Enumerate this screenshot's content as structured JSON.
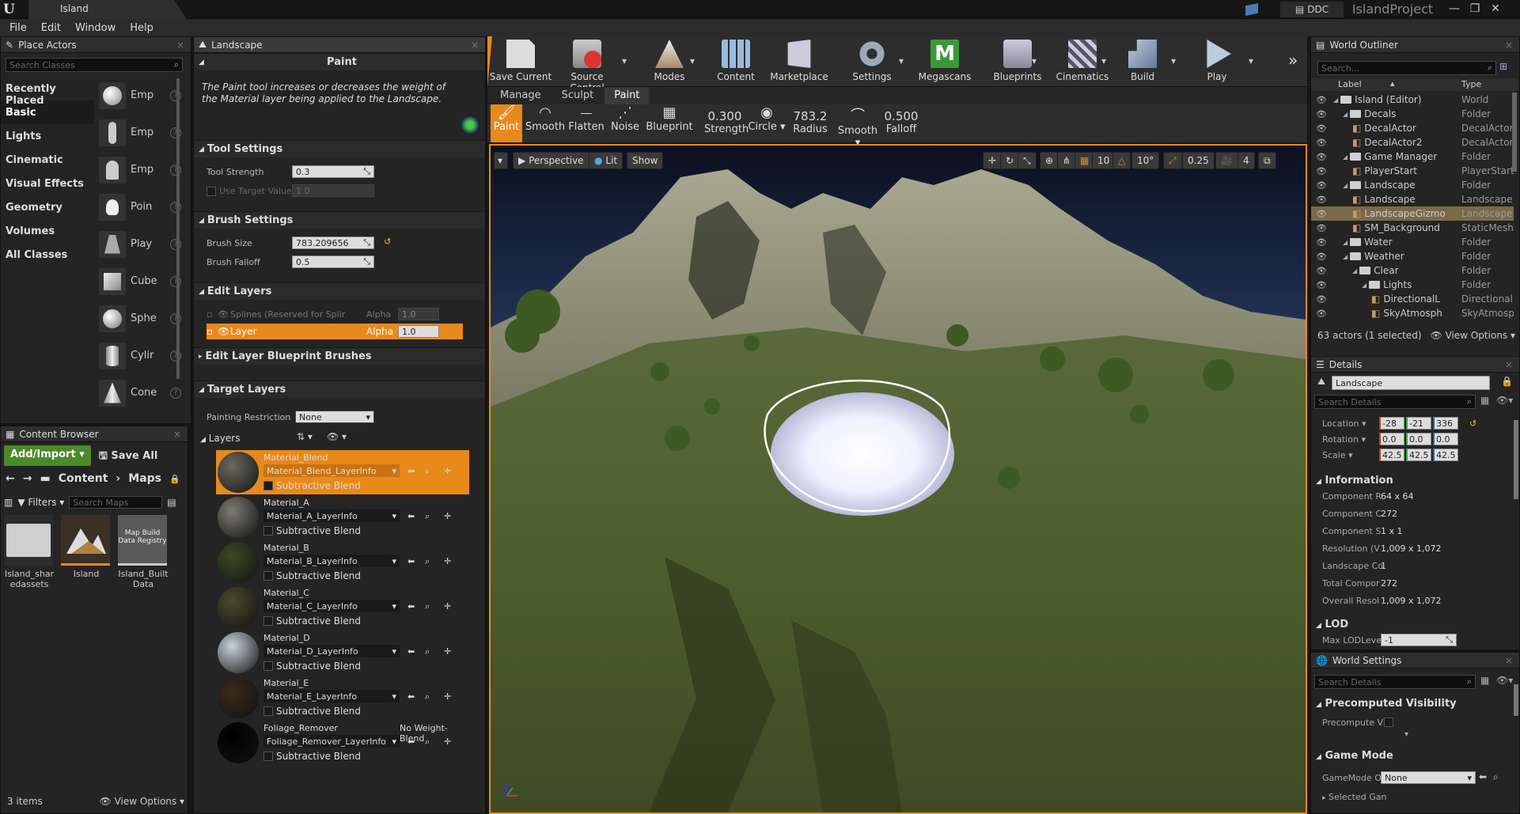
{
  "window": {
    "tab_title": "Island",
    "ddc_label": "DDC",
    "project": "IslandProject"
  },
  "menu": [
    "File",
    "Edit",
    "Window",
    "Help"
  ],
  "place_actors": {
    "title": "Place Actors",
    "search_placeholder": "Search Classes",
    "categories": [
      "Recently Placed",
      "Basic",
      "Lights",
      "Cinematic",
      "Visual Effects",
      "Geometry",
      "Volumes",
      "All Classes"
    ],
    "selected_category": "Basic",
    "items": [
      "Emp",
      "Emp",
      "Emp",
      "Poin",
      "Play",
      "Cube",
      "Sphe",
      "Cylir",
      "Cone"
    ]
  },
  "content_browser": {
    "title": "Content Browser",
    "add_import": "Add/Import",
    "save_all": "Save All",
    "path": [
      "Content",
      "Maps"
    ],
    "filters": "Filters",
    "search_placeholder": "Search Maps",
    "items": [
      {
        "label": "Island_sharedassets",
        "kind": "folder"
      },
      {
        "label": "Island",
        "kind": "map"
      },
      {
        "label": "Island_BuiltData",
        "kind": "registry",
        "thumb_text": "Map Build Data Registry"
      }
    ],
    "status": "3 items",
    "view_options": "View Options"
  },
  "landscape": {
    "title": "Landscape",
    "section": "Paint",
    "description": "The Paint tool increases or decreases the weight of the Material layer being applied to the Landscape.",
    "tool_settings": {
      "header": "Tool Settings",
      "strength_label": "Tool Strength",
      "strength": "0.3",
      "use_target_label": "Use Target Value",
      "target": "1.0"
    },
    "brush_settings": {
      "header": "Brush Settings",
      "size_label": "Brush Size",
      "size": "783.209656",
      "falloff_label": "Brush Falloff",
      "falloff": "0.5"
    },
    "edit_layers": {
      "header": "Edit Layers",
      "rows": [
        {
          "name": "Splines (Reserved for Splir",
          "alpha_label": "Alpha",
          "alpha": "1.0"
        },
        {
          "name": "Layer",
          "alpha_label": "Alpha",
          "alpha": "1.0"
        }
      ]
    },
    "blueprint_brushes": "Edit Layer Blueprint Brushes",
    "target_layers": {
      "header": "Target Layers",
      "restriction_label": "Painting Restriction",
      "restriction": "None",
      "layers_label": "Layers",
      "layers": [
        {
          "name": "Material_Blend",
          "info": "Material_Blend_LayerInfo",
          "sub": "Subtractive Blend",
          "color": "#6b6a5e",
          "extra": ""
        },
        {
          "name": "Material_A",
          "info": "Material_A_LayerInfo",
          "sub": "Subtractive Blend",
          "color": "#7d7b73",
          "extra": ""
        },
        {
          "name": "Material_B",
          "info": "Material_B_LayerInfo",
          "sub": "Subtractive Blend",
          "color": "#3c4a26",
          "extra": ""
        },
        {
          "name": "Material_C",
          "info": "Material_C_LayerInfo",
          "sub": "Subtractive Blend",
          "color": "#4a4a2e",
          "extra": ""
        },
        {
          "name": "Material_D",
          "info": "Material_D_LayerInfo",
          "sub": "Subtractive Blend",
          "color": "#c8d2dc",
          "extra": ""
        },
        {
          "name": "Material_E",
          "info": "Material_E_LayerInfo",
          "sub": "Subtractive Blend",
          "color": "#3a2a1c",
          "extra": ""
        },
        {
          "name": "Foliage_Remover",
          "info": "Foliage_Remover_LayerInfo",
          "sub": "Subtractive Blend",
          "color": "#000000",
          "extra": "No Weight-Blend"
        }
      ]
    }
  },
  "toolbar": {
    "buttons": [
      "Save Current",
      "Source Control",
      "Modes",
      "Content",
      "Marketplace",
      "Settings",
      "Megascans",
      "Blueprints",
      "Cinematics",
      "Build",
      "Play"
    ]
  },
  "mode_tabs": [
    "Manage",
    "Sculpt",
    "Paint"
  ],
  "paint_tools": {
    "tools": [
      "Paint",
      "Smooth",
      "Flatten",
      "Noise",
      "Blueprint"
    ],
    "strength": {
      "value": "0.300",
      "label": "Strength"
    },
    "circle": "Circle",
    "radius": {
      "value": "783.2",
      "label": "Radius"
    },
    "smooth": "Smooth",
    "falloff": {
      "value": "0.500",
      "label": "Falloff"
    }
  },
  "viewport": {
    "perspective": "Perspective",
    "lit": "Lit",
    "show": "Show",
    "grid": "10",
    "angle": "10°",
    "scale": "0.25",
    "speed": "4"
  },
  "outliner": {
    "title": "World Outliner",
    "search_placeholder": "Search...",
    "col_label": "Label",
    "col_type": "Type",
    "rows": [
      {
        "label": "Island (Editor)",
        "type": "World",
        "indent": 0
      },
      {
        "label": "Decals",
        "type": "Folder",
        "indent": 1
      },
      {
        "label": "DecalActor",
        "type": "DecalActor",
        "indent": 2
      },
      {
        "label": "DecalActor2",
        "type": "DecalActor",
        "indent": 2
      },
      {
        "label": "Game Manager",
        "type": "Folder",
        "indent": 1
      },
      {
        "label": "PlayerStart",
        "type": "PlayerStart",
        "indent": 2
      },
      {
        "label": "Landscape",
        "type": "Folder",
        "indent": 1
      },
      {
        "label": "Landscape",
        "type": "Landscape",
        "indent": 2
      },
      {
        "label": "LandscapeGizmo",
        "type": "Landscape",
        "indent": 2
      },
      {
        "label": "SM_Background",
        "type": "StaticMesh",
        "indent": 2
      },
      {
        "label": "Water",
        "type": "Folder",
        "indent": 1
      },
      {
        "label": "Weather",
        "type": "Folder",
        "indent": 1
      },
      {
        "label": "Clear",
        "type": "Folder",
        "indent": 2
      },
      {
        "label": "Lights",
        "type": "Folder",
        "indent": 3
      },
      {
        "label": "DirectionalL",
        "type": "DirectionalL",
        "indent": 4
      },
      {
        "label": "SkyAtmosph",
        "type": "SkyAtmosp",
        "indent": 4
      }
    ],
    "selected_row": "LandscapeGizmo",
    "status": "63 actors (1 selected)",
    "view_options": "View Options"
  },
  "details": {
    "title": "Details",
    "name": "Landscape",
    "search_placeholder": "Search Details",
    "transform": [
      {
        "label": "Location",
        "vals": [
          "-28",
          "-21",
          "336"
        ]
      },
      {
        "label": "Rotation",
        "vals": [
          "0.0",
          "0.0",
          "0.0"
        ]
      },
      {
        "label": "Scale",
        "vals": [
          "42.5",
          "42.5",
          "42.5"
        ]
      }
    ],
    "info_header": "Information",
    "info": [
      {
        "k": "Component R",
        "v": "64 x 64"
      },
      {
        "k": "Component C",
        "v": "272"
      },
      {
        "k": "Component S",
        "v": "1 x 1"
      },
      {
        "k": "Resolution (V",
        "v": "1,009 x 1,072"
      },
      {
        "k": "Landscape Co",
        "v": "1"
      },
      {
        "k": "Total Compor",
        "v": "272"
      },
      {
        "k": "Overall Resol",
        "v": "1,009 x 1,072"
      }
    ],
    "lod_header": "LOD",
    "lod_label": "Max LODLeve",
    "lod_value": "-1"
  },
  "world_settings": {
    "title": "World Settings",
    "search_placeholder": "Search Details",
    "precomp_header": "Precomputed Visibility",
    "precomp_label": "Precompute V",
    "gamemode_header": "Game Mode",
    "gamemode_label": "GameMode O",
    "gamemode_value": "None",
    "selected_label": "Selected Gan"
  }
}
